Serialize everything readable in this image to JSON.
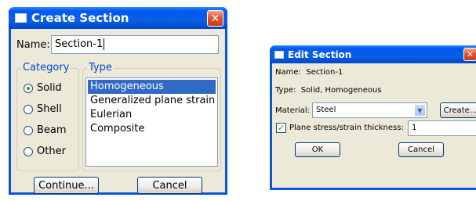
{
  "create_section": {
    "title": "Create Section",
    "name_label": "Name:",
    "name_value": "Section-1",
    "category_label": "Category",
    "categories": [
      "Solid",
      "Shell",
      "Beam",
      "Other"
    ],
    "selected_category": "Solid",
    "type_label": "Type",
    "types": [
      "Homogeneous",
      "Generalized plane strain",
      "Eulerian",
      "Composite"
    ],
    "selected_type": "Homogeneous",
    "continue_label": "Continue...",
    "cancel_label": "Cancel"
  },
  "edit_section": {
    "title": "Edit Section",
    "name_line": "Name:  Section-1",
    "type_line": "Type:  Solid, Homogeneous",
    "material_label": "Material:",
    "material_value": "Steel",
    "create_label": "Create...",
    "thickness_label": "Plane stress/strain thickness:",
    "thickness_checked": true,
    "thickness_value": "1",
    "ok_label": "OK",
    "cancel_label": "Cancel"
  },
  "colors": {
    "titlebar_blue": "#0058ee",
    "dialog_bg": "#ece9d8",
    "selection_blue": "#316ac5",
    "close_red": "#e1542c"
  }
}
